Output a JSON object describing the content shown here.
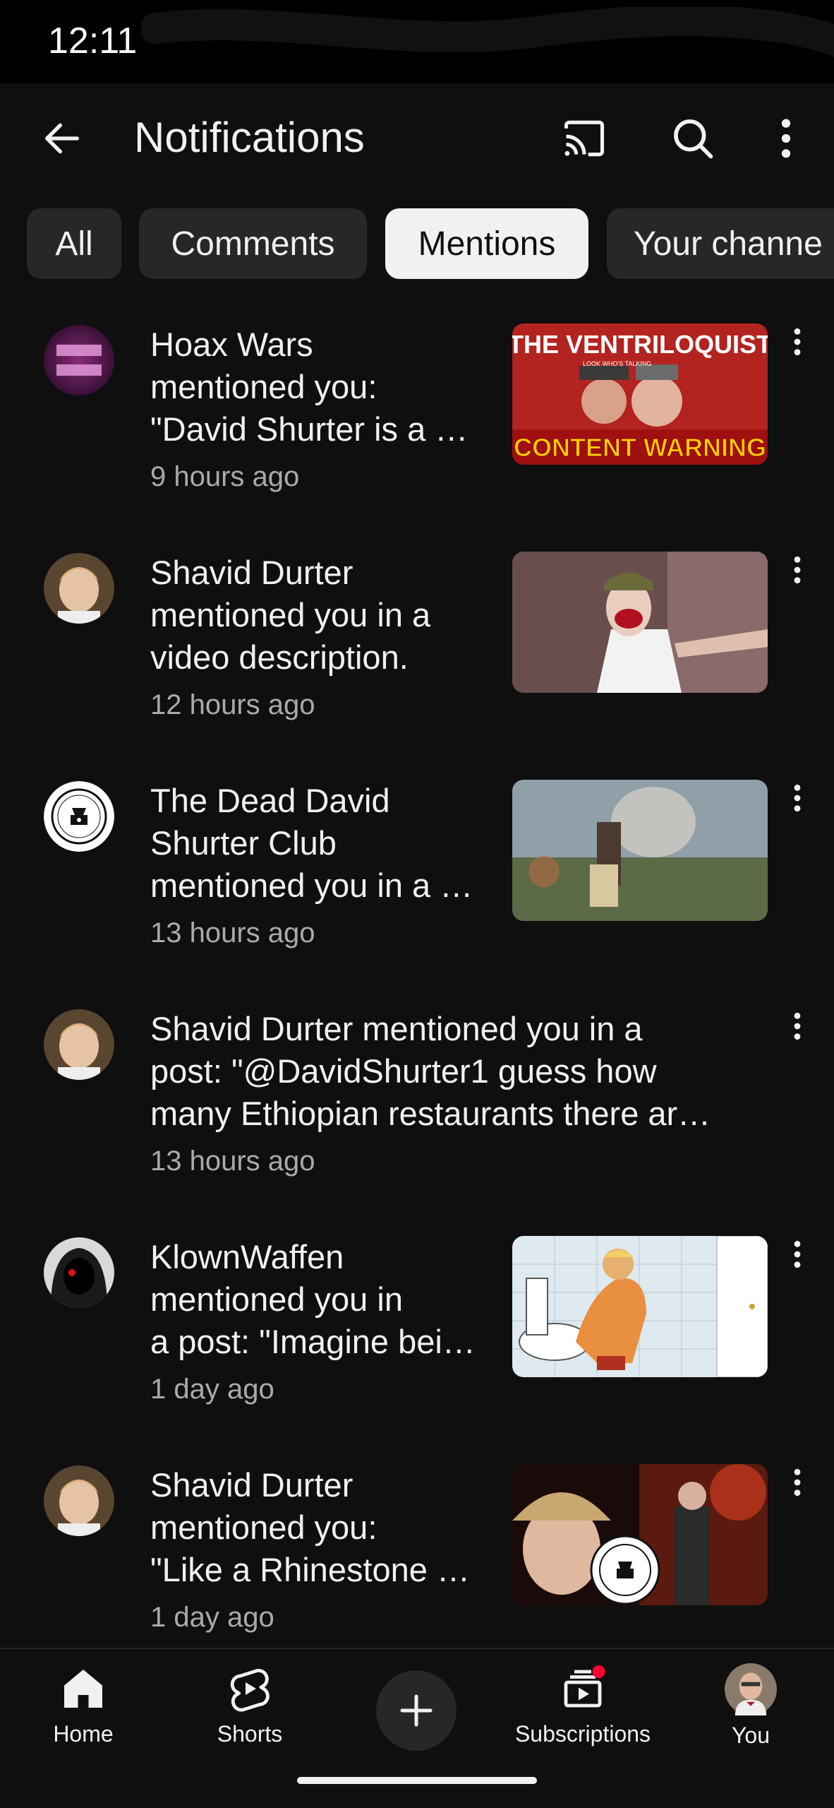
{
  "status_bar": {
    "time": "12:11"
  },
  "header": {
    "title": "Notifications"
  },
  "chips": [
    {
      "label": "All",
      "active": false
    },
    {
      "label": "Comments",
      "active": false
    },
    {
      "label": "Mentions",
      "active": true
    },
    {
      "label": "Your channe",
      "active": false
    }
  ],
  "notifications": [
    {
      "lines": [
        "Hoax Wars",
        "mentioned you:",
        "\"David Shurter is a …"
      ],
      "time": "9 hours ago",
      "avatar": "hoax-wars-avatar",
      "thumb": {
        "title": "THE VENTRILOQUIST",
        "subtitle": "LOOK WHO'S TALKING",
        "banner": "CONTENT WARNING"
      }
    },
    {
      "lines": [
        "Shavid Durter",
        "mentioned you in a",
        "video description."
      ],
      "time": "12 hours ago",
      "avatar": "child-photo-avatar",
      "thumb": {}
    },
    {
      "lines": [
        "The Dead David",
        "Shurter Club",
        "mentioned you in a …"
      ],
      "time": "13 hours ago",
      "avatar": "club-logo-avatar",
      "thumb": {}
    },
    {
      "lines": [
        "Shavid Durter mentioned you in a",
        "post: \"@DavidShurter1 guess how",
        "many Ethiopian restaurants there ar…"
      ],
      "time": "13 hours ago",
      "avatar": "child-photo-avatar",
      "thumb": null
    },
    {
      "lines": [
        "KlownWaffen",
        "mentioned you in",
        "a post: \"Imagine bei…"
      ],
      "time": "1 day ago",
      "avatar": "dark-hood-avatar",
      "thumb": {}
    },
    {
      "lines": [
        "Shavid Durter",
        "mentioned you:",
        "\"Like a Rhinestone …"
      ],
      "time": "1 day ago",
      "avatar": "child-photo-avatar",
      "thumb": {}
    }
  ],
  "bottom_nav": {
    "home": "Home",
    "shorts": "Shorts",
    "subscriptions": "Subscriptions",
    "you": "You"
  },
  "colors": {
    "background": "#0f0f0f",
    "chip": "#272727",
    "chip_active": "#f1f1f1",
    "secondary_text": "#aaaaaa",
    "badge": "#ff0033"
  }
}
